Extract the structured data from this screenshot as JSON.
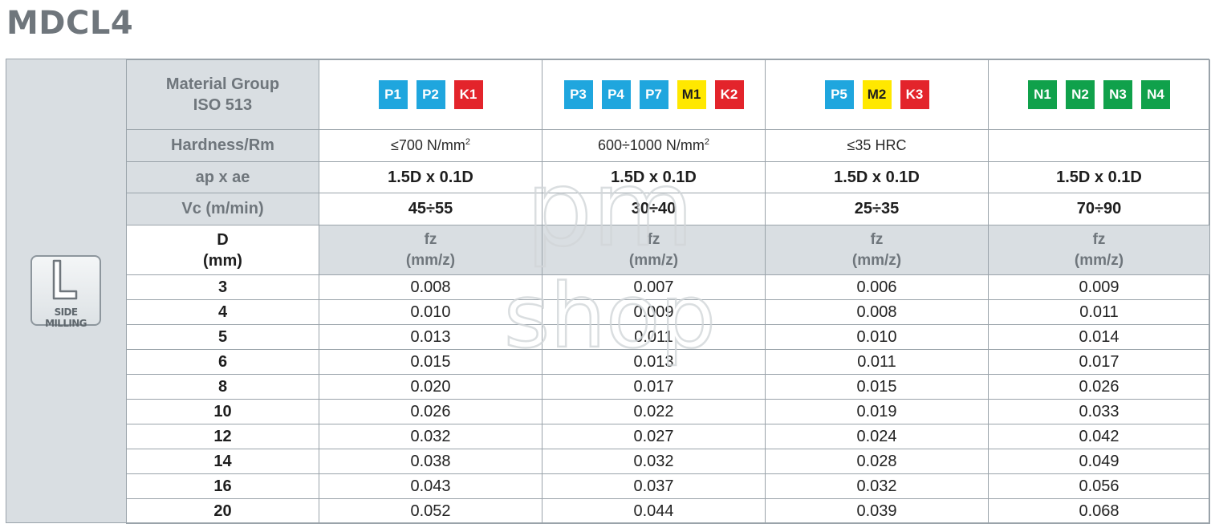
{
  "title": "MDCL4",
  "side": {
    "icon_name": "side-milling-icon",
    "label": "SIDE MILLING"
  },
  "colors": {
    "P": "#1fa6de",
    "M": "#ffe800",
    "K": "#e3242b",
    "N": "#10a14b"
  },
  "header": {
    "material_label": [
      "Material Group",
      "ISO 513"
    ],
    "hardness_label": "Hardness/Rm",
    "apae_label": "ap x ae",
    "vc_label": "Vc (m/min)",
    "d_label": [
      "D",
      "(mm)"
    ],
    "fz_label": [
      "fz",
      "(mm/z)"
    ]
  },
  "groups": [
    {
      "badges": [
        {
          "code": "P1",
          "color": "P"
        },
        {
          "code": "P2",
          "color": "P"
        },
        {
          "code": "K1",
          "color": "K"
        }
      ],
      "hardness_prefix": "≤700 N/mm",
      "hardness_sup": "2",
      "apae": "1.5D x 0.1D",
      "vc": "45÷55"
    },
    {
      "badges": [
        {
          "code": "P3",
          "color": "P"
        },
        {
          "code": "P4",
          "color": "P"
        },
        {
          "code": "P7",
          "color": "P"
        },
        {
          "code": "M1",
          "color": "M"
        },
        {
          "code": "K2",
          "color": "K"
        }
      ],
      "hardness_prefix": "600÷1000 N/mm",
      "hardness_sup": "2",
      "apae": "1.5D x 0.1D",
      "vc": "30÷40"
    },
    {
      "badges": [
        {
          "code": "P5",
          "color": "P"
        },
        {
          "code": "M2",
          "color": "M"
        },
        {
          "code": "K3",
          "color": "K"
        }
      ],
      "hardness_prefix": "≤35 HRC",
      "hardness_sup": "",
      "apae": "1.5D x 0.1D",
      "vc": "25÷35"
    },
    {
      "badges": [
        {
          "code": "N1",
          "color": "N"
        },
        {
          "code": "N2",
          "color": "N"
        },
        {
          "code": "N3",
          "color": "N"
        },
        {
          "code": "N4",
          "color": "N"
        }
      ],
      "hardness_prefix": "",
      "hardness_sup": "",
      "apae": "1.5D x 0.1D",
      "vc": "70÷90"
    }
  ],
  "rows": [
    {
      "d": "3",
      "fz": [
        "0.008",
        "0.007",
        "0.006",
        "0.009"
      ]
    },
    {
      "d": "4",
      "fz": [
        "0.010",
        "0.009",
        "0.008",
        "0.011"
      ]
    },
    {
      "d": "5",
      "fz": [
        "0.013",
        "0.011",
        "0.010",
        "0.014"
      ]
    },
    {
      "d": "6",
      "fz": [
        "0.015",
        "0.013",
        "0.011",
        "0.017"
      ]
    },
    {
      "d": "8",
      "fz": [
        "0.020",
        "0.017",
        "0.015",
        "0.026"
      ]
    },
    {
      "d": "10",
      "fz": [
        "0.026",
        "0.022",
        "0.019",
        "0.033"
      ]
    },
    {
      "d": "12",
      "fz": [
        "0.032",
        "0.027",
        "0.024",
        "0.042"
      ]
    },
    {
      "d": "14",
      "fz": [
        "0.038",
        "0.032",
        "0.028",
        "0.049"
      ]
    },
    {
      "d": "16",
      "fz": [
        "0.043",
        "0.037",
        "0.032",
        "0.056"
      ]
    },
    {
      "d": "20",
      "fz": [
        "0.052",
        "0.044",
        "0.039",
        "0.068"
      ]
    }
  ],
  "watermark": {
    "line1": "pm",
    "line2": "shop"
  }
}
